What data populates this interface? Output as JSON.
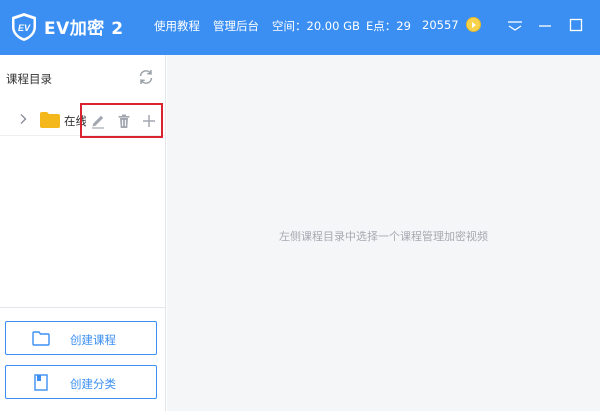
{
  "header": {
    "app_title": "EV加密 2",
    "nav": {
      "tutorial": "使用教程",
      "admin": "管理后台"
    },
    "stats": {
      "space": "空间：20.00 GB",
      "e_points": "E点：29",
      "coins": "20557"
    }
  },
  "sidebar": {
    "title": "课程目录",
    "tree": [
      {
        "label": "在线"
      }
    ],
    "footer": {
      "create_course": "创建课程",
      "create_category": "创建分类"
    }
  },
  "main": {
    "empty_hint": "左侧课程目录中选择一个课程管理加密视频"
  },
  "colors": {
    "accent": "#3b8ff3",
    "highlight_box": "#d9232e",
    "folder": "#f5b81c",
    "main_bg": "#f5f6f8"
  },
  "icons": {
    "logo": "ev-shield-logo-icon",
    "coin": "coin-icon",
    "refresh": "refresh-icon",
    "edit": "pencil-icon",
    "delete": "trash-icon",
    "add": "plus-icon"
  }
}
